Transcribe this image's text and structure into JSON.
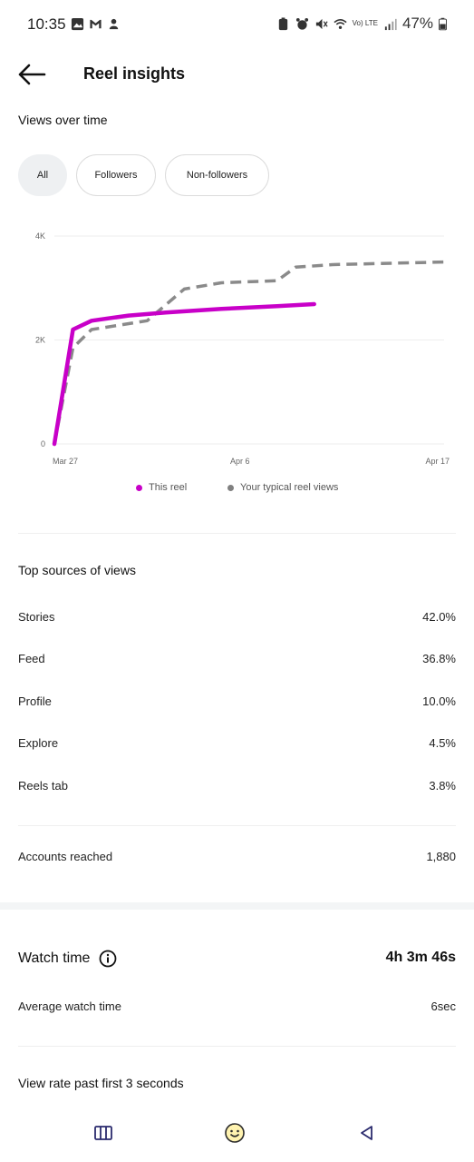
{
  "status_bar": {
    "time": "10:35",
    "battery": "47%",
    "network": "Vo) LTE"
  },
  "header": {
    "title": "Reel insights"
  },
  "views_section": {
    "title": "Views over time",
    "filters": [
      "All",
      "Followers",
      "Non-followers"
    ],
    "selected_filter": "All"
  },
  "chart_data": {
    "type": "line",
    "x_tick_labels": [
      "Mar 27",
      "Apr 6",
      "Apr 17"
    ],
    "y_tick_labels": [
      "4K",
      "2K",
      "0"
    ],
    "ylim": [
      0,
      4000
    ],
    "grid": true,
    "legend_position": "bottom",
    "series": [
      {
        "name": "This reel",
        "color": "#c800c8",
        "style": "solid",
        "points": [
          {
            "x": "Mar 27",
            "y": 0
          },
          {
            "x": "Mar 28",
            "y": 2200
          },
          {
            "x": "Mar 29",
            "y": 2370
          },
          {
            "x": "Mar 31",
            "y": 2470
          },
          {
            "x": "Apr 2",
            "y": 2530
          },
          {
            "x": "Apr 5",
            "y": 2600
          },
          {
            "x": "Apr 8",
            "y": 2650
          },
          {
            "x": "Apr 10",
            "y": 2690
          }
        ]
      },
      {
        "name": "Your typical reel views",
        "color": "#8a8a8a",
        "style": "dashed",
        "points": [
          {
            "x": "Mar 27",
            "y": 0
          },
          {
            "x": "Mar 28",
            "y": 1850
          },
          {
            "x": "Mar 29",
            "y": 2200
          },
          {
            "x": "Apr 1",
            "y": 2370
          },
          {
            "x": "Apr 3",
            "y": 2980
          },
          {
            "x": "Apr 5",
            "y": 3100
          },
          {
            "x": "Apr 8",
            "y": 3140
          },
          {
            "x": "Apr 9",
            "y": 3400
          },
          {
            "x": "Apr 11",
            "y": 3450
          },
          {
            "x": "Apr 17",
            "y": 3500
          }
        ]
      }
    ]
  },
  "top_sources": {
    "title": "Top sources of views",
    "rows": [
      {
        "label": "Stories",
        "value": "42.0%"
      },
      {
        "label": "Feed",
        "value": "36.8%"
      },
      {
        "label": "Profile",
        "value": "10.0%"
      },
      {
        "label": "Explore",
        "value": "4.5%"
      },
      {
        "label": "Reels tab",
        "value": "3.8%"
      }
    ]
  },
  "accounts_reached": {
    "label": "Accounts reached",
    "value": "1,880"
  },
  "watch_time": {
    "label": "Watch time",
    "value": "4h 3m 46s",
    "average_label": "Average watch time",
    "average_value": "6sec"
  },
  "view_rate": {
    "title": "View rate past first 3 seconds"
  },
  "colors": {
    "this_reel": "#c800c8",
    "typical": "#8a8a8a",
    "chip_selected_bg": "#eef0f2"
  },
  "icons": {
    "back": "arrow-left-icon",
    "info": "info-circle-icon",
    "nav_recents": "recents-icon",
    "nav_home": "home-icon",
    "nav_back": "triangle-back-icon"
  }
}
